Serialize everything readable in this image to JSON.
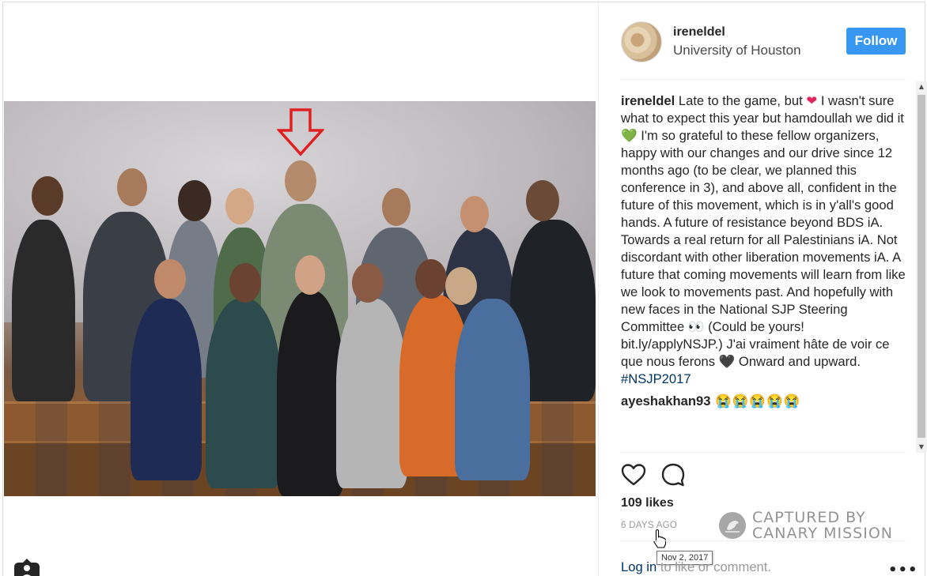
{
  "post": {
    "username": "ireneldel",
    "location": "University of Houston",
    "follow_label": "Follow",
    "caption_username": "ireneldel",
    "caption_part1": " Late to the game, but ",
    "caption_part2": " I wasn't sure what to expect this year but hamdoullah we did it ",
    "caption_part3": "  I'm so grateful to these fellow organizers, happy with our changes and our drive since 12 months ago (to be clear, we planned this conference in 3), and above all, confident in the future of this movement, which is in y'all's good hands. A future of resistance beyond BDS iA. Towards a real return for all Palestinians iA. Not discordant with other liberation movements iA. A future that coming movements will learn from like we look to movements past. And hopefully with new faces in the National SJP Steering Committee ",
    "caption_part4": " (Could be yours! bit.ly/applyNSJP.) J'ai vraiment hâte de voir ce que nous ferons ",
    "caption_part5": " Onward and upward. ",
    "caption_hashtag": "#NSJP2017",
    "emoji_red_heart": "❤",
    "emoji_green_heart": "💚",
    "emoji_eyes": "👀",
    "emoji_black_heart": "🖤",
    "comment2_username": "ayeshakhan93",
    "comment2_text": " 😭😭😭😭😭",
    "likes": "109 likes",
    "time_ago": "6 DAYS AGO",
    "tooltip_date": "Nov 2, 2017",
    "login_link": "Log in",
    "login_rest": " to like or comment.",
    "more_label": "•••"
  },
  "watermark": {
    "line1": "CAPTURED BY",
    "line2": "CANARY MISSION"
  },
  "colors": {
    "follow_button": "#3897f0",
    "link": "#003569",
    "arrow": "#e02020"
  }
}
